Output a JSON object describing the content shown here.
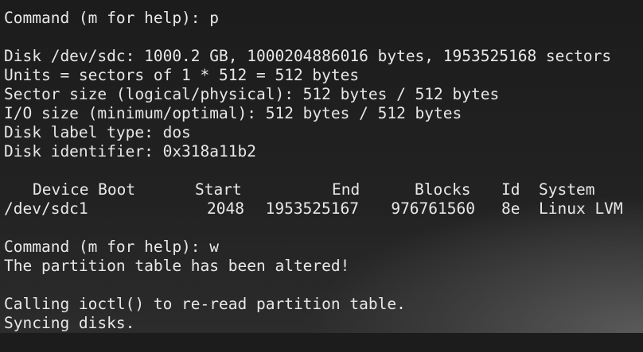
{
  "terminal": {
    "prompt1": "Command (m for help): p",
    "disk_info": [
      "Disk /dev/sdc: 1000.2 GB, 1000204886016 bytes, 1953525168 sectors",
      "Units = sectors of 1 * 512 = 512 bytes",
      "Sector size (logical/physical): 512 bytes / 512 bytes",
      "I/O size (minimum/optimal): 512 bytes / 512 bytes",
      "Disk label type: dos",
      "Disk identifier: 0x318a11b2"
    ],
    "table": {
      "headers": {
        "device_boot": "Device Boot",
        "start": "Start",
        "end": "End",
        "blocks": "Blocks",
        "id": "Id",
        "system": "System"
      },
      "rows": [
        {
          "device": "/dev/sdc1",
          "start": "2048",
          "end": "1953525167",
          "blocks": "976761560",
          "id": "8e",
          "system": "Linux LVM"
        }
      ]
    },
    "prompt2": "Command (m for help): w",
    "altered_msg": "The partition table has been altered!",
    "ioctl_msg": "Calling ioctl() to re-read partition table.",
    "sync_msg": "Syncing disks."
  }
}
